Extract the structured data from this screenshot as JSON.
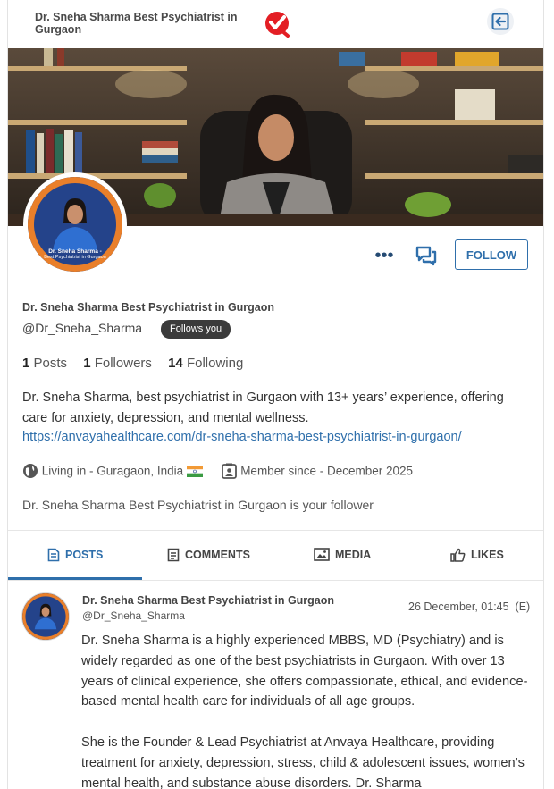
{
  "header": {
    "title": "Dr. Sneha Sharma Best Psychiatrist in Gurgaon"
  },
  "avatar": {
    "caption_name": "Dr. Sneha Sharma -",
    "caption_sub": "Best Psychiatrist in Gurgaon"
  },
  "actions": {
    "more_label": "•••",
    "follow_label": "FOLLOW"
  },
  "profile": {
    "name": "Dr. Sneha Sharma Best Psychiatrist in Gurgaon",
    "handle": "@Dr_Sneha_Sharma",
    "follows_badge": "Follows you",
    "posts_count": "1",
    "posts_label": "Posts",
    "followers_count": "1",
    "followers_label": "Followers",
    "following_count": "14",
    "following_label": "Following",
    "bio": "Dr. Sneha Sharma, best psychiatrist in Gurgaon with 13+ years’ experience, offering care for anxiety, depression, and mental wellness.",
    "link": "https://anvayahealthcare.com/dr-sneha-sharma-best-psychiatrist-in-gurgaon/",
    "location": "Living in - Guragaon, India",
    "member_since": "Member since - December 2025",
    "follower_note": "Dr. Sneha Sharma Best Psychiatrist in Gurgaon is your follower"
  },
  "tabs": [
    {
      "label": "POSTS",
      "icon": "document-icon"
    },
    {
      "label": "COMMENTS",
      "icon": "comment-icon"
    },
    {
      "label": "MEDIA",
      "icon": "image-icon"
    },
    {
      "label": "LIKES",
      "icon": "thumbs-up-icon"
    }
  ],
  "post": {
    "author": "Dr. Sneha Sharma Best Psychiatrist in Gurgaon",
    "handle": "@Dr_Sneha_Sharma",
    "time": "26 December, 01:45",
    "edited": "(E)",
    "paragraph1": "Dr. Sneha Sharma is a highly experienced MBBS, MD (Psychiatry) and is widely regarded as one of the best psychiatrists in Gurgaon. With over 13 years of clinical experience, she offers compassionate, ethical, and evidence-based mental health care for individuals of all age groups.",
    "paragraph2": "She is the Founder & Lead Psychiatrist at Anvaya Healthcare, providing treatment for anxiety, depression, stress, child & adolescent issues, women’s mental health, and substance abuse disorders. Dr. Sharma"
  },
  "colors": {
    "accent": "#2f6fab",
    "brand_red": "#e31e24",
    "badge_bg": "#3b3b3b"
  }
}
